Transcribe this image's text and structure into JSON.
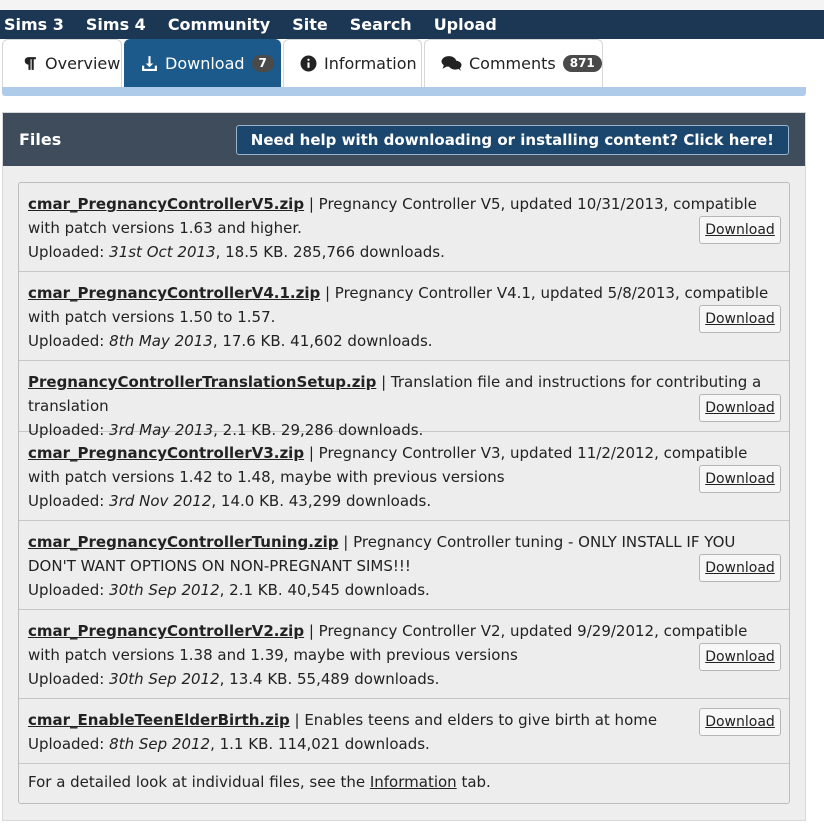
{
  "nav": [
    "Sims 3",
    "Sims 4",
    "Community",
    "Site",
    "Search",
    "Upload"
  ],
  "tabs": [
    {
      "label": "Overview",
      "icon": "pilcrow-icon",
      "badge": null
    },
    {
      "label": "Download",
      "icon": "download-icon",
      "badge": "7",
      "active": true
    },
    {
      "label": "Information",
      "icon": "info-circle-icon",
      "badge": null
    },
    {
      "label": "Comments",
      "icon": "comments-icon",
      "badge": "871"
    }
  ],
  "panel": {
    "title": "Files",
    "help_button": "Need help with downloading or installing content? Click here!"
  },
  "files": [
    {
      "name": "cmar_PregnancyControllerV5.zip",
      "desc": "Pregnancy Controller V5, updated 10/31/2013, compatible with patch versions 1.63 and higher.",
      "uploaded_label": "Uploaded:",
      "date": "31st Oct 2013",
      "meta": ", 18.5 KB. 285,766 downloads.",
      "button": "Download"
    },
    {
      "name": "cmar_PregnancyControllerV4.1.zip",
      "desc": "Pregnancy Controller V4.1, updated 5/8/2013, compatible with patch versions 1.50 to 1.57.",
      "uploaded_label": "Uploaded:",
      "date": "8th May 2013",
      "meta": ", 17.6 KB. 41,602 downloads.",
      "button": "Download"
    },
    {
      "name": "PregnancyControllerTranslationSetup.zip",
      "desc": "Translation file and instructions for contributing a translation",
      "uploaded_label": "Uploaded:",
      "date": "3rd May 2013",
      "meta": ", 2.1 KB. 29,286 downloads.",
      "button": "Download"
    },
    {
      "name": "cmar_PregnancyControllerV3.zip",
      "desc": "Pregnancy Controller V3, updated 11/2/2012, compatible with patch versions 1.42 to 1.48, maybe with previous versions",
      "uploaded_label": "Uploaded:",
      "date": "3rd Nov 2012",
      "meta": ", 14.0 KB. 43,299 downloads.",
      "button": "Download"
    },
    {
      "name": "cmar_PregnancyControllerTuning.zip",
      "desc": "Pregnancy Controller tuning - ONLY INSTALL IF YOU DON'T WANT OPTIONS ON NON-PREGNANT SIMS!!!",
      "uploaded_label": "Uploaded:",
      "date": "30th Sep 2012",
      "meta": ", 2.1 KB. 40,545 downloads.",
      "button": "Download"
    },
    {
      "name": "cmar_PregnancyControllerV2.zip",
      "desc": "Pregnancy Controller V2, updated 9/29/2012, compatible with patch versions 1.38 and 1.39, maybe with previous versions",
      "uploaded_label": "Uploaded:",
      "date": "30th Sep 2012",
      "meta": ", 13.4 KB. 55,489 downloads.",
      "button": "Download"
    },
    {
      "name": "cmar_EnableTeenElderBirth.zip",
      "desc": "Enables teens and elders to give birth at home",
      "uploaded_label": "Uploaded:",
      "date": "8th Sep 2012",
      "meta": ", 1.1 KB. 114,021 downloads.",
      "button": "Download"
    }
  ],
  "footnote": {
    "before": "For a detailed look at individual files, see the ",
    "link": "Information",
    "after": " tab."
  },
  "colors": {
    "nav_bg": "#1c3753",
    "active_tab": "#1b5a8a",
    "panel_head": "#3e4c5b",
    "help_button": "#1b466e"
  }
}
